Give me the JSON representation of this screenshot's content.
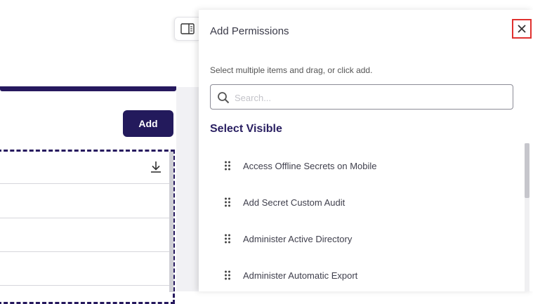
{
  "background_page": {
    "add_button_label": "Add"
  },
  "panel": {
    "title": "Add Permissions",
    "instructions": "Select multiple items and drag, or click add.",
    "search": {
      "placeholder": "Search...",
      "value": ""
    },
    "select_visible_label": "Select Visible",
    "items": [
      {
        "label": "Access Offline Secrets on Mobile"
      },
      {
        "label": "Add Secret Custom Audit"
      },
      {
        "label": "Administer Active Directory"
      },
      {
        "label": "Administer Automatic Export"
      }
    ]
  },
  "icons": {
    "close": "close-icon",
    "search": "search-icon",
    "toggle_panel": "side-panel-icon",
    "download": "download-icon",
    "drag": "drag-handle-icon"
  },
  "colors": {
    "brand": "#231a5c",
    "close_highlight": "#e0312f"
  }
}
